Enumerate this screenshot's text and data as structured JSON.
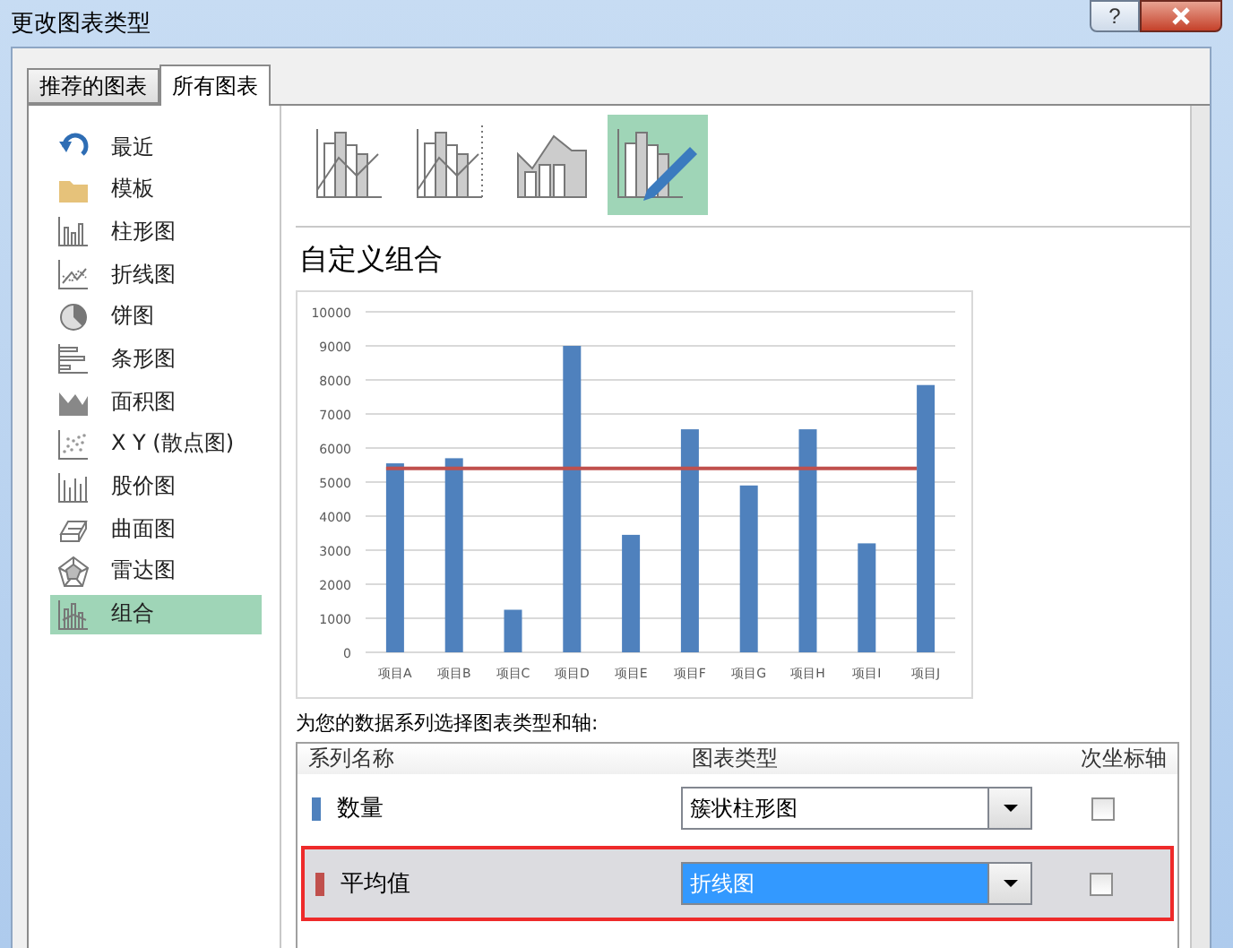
{
  "window": {
    "title": "更改图表类型",
    "help_button": "?"
  },
  "tabs": [
    {
      "label": "推荐的图表",
      "selected": false
    },
    {
      "label": "所有图表",
      "selected": true
    }
  ],
  "sidebar": {
    "items": [
      {
        "label": "最近",
        "kind": "recent",
        "selected": false
      },
      {
        "label": "模板",
        "kind": "template",
        "selected": false
      },
      {
        "label": "柱形图",
        "kind": "column",
        "selected": false
      },
      {
        "label": "折线图",
        "kind": "line",
        "selected": false
      },
      {
        "label": "饼图",
        "kind": "pie",
        "selected": false
      },
      {
        "label": "条形图",
        "kind": "bar",
        "selected": false
      },
      {
        "label": "面积图",
        "kind": "area",
        "selected": false
      },
      {
        "label": "X Y (散点图)",
        "kind": "scatter",
        "selected": false
      },
      {
        "label": "股价图",
        "kind": "stock",
        "selected": false
      },
      {
        "label": "曲面图",
        "kind": "surface",
        "selected": false
      },
      {
        "label": "雷达图",
        "kind": "radar",
        "selected": false
      },
      {
        "label": "组合",
        "kind": "combo",
        "selected": true
      }
    ]
  },
  "subtypes": [
    {
      "kind": "column-line",
      "selected": false
    },
    {
      "kind": "column-line-secondary",
      "selected": false
    },
    {
      "kind": "area-column",
      "selected": false
    },
    {
      "kind": "custom",
      "selected": true
    }
  ],
  "heading": "自定义组合",
  "chart": {
    "chart_data": {
      "type": "bar",
      "categories": [
        "项目A",
        "项目B",
        "项目C",
        "项目D",
        "项目E",
        "项目F",
        "项目G",
        "项目H",
        "项目I",
        "项目J"
      ],
      "series": [
        {
          "type": "bar",
          "color": "#4f81bd",
          "values": [
            5550,
            5700,
            1250,
            9000,
            3450,
            6550,
            4900,
            6550,
            3200,
            7850
          ]
        },
        {
          "type": "line",
          "color": "#c0504d",
          "values": [
            5400,
            5400,
            5400,
            5400,
            5400,
            5400,
            5400,
            5400,
            5400,
            5400
          ]
        }
      ],
      "grid": true,
      "ylim": [
        0,
        10000
      ],
      "yticks": [
        0,
        1000,
        2000,
        3000,
        4000,
        5000,
        6000,
        7000,
        8000,
        9000,
        10000
      ]
    }
  },
  "series_prompt": "为您的数据系列选择图表类型和轴:",
  "table": {
    "columns": [
      "系列名称",
      "图表类型",
      "次坐标轴"
    ],
    "rows": [
      {
        "name": "数量",
        "color": "#4f81bd",
        "chart_type": "簇状柱形图",
        "secondary_axis": false,
        "selected": false
      },
      {
        "name": "平均值",
        "color": "#c0504d",
        "chart_type": "折线图",
        "secondary_axis": false,
        "selected": true
      }
    ]
  }
}
